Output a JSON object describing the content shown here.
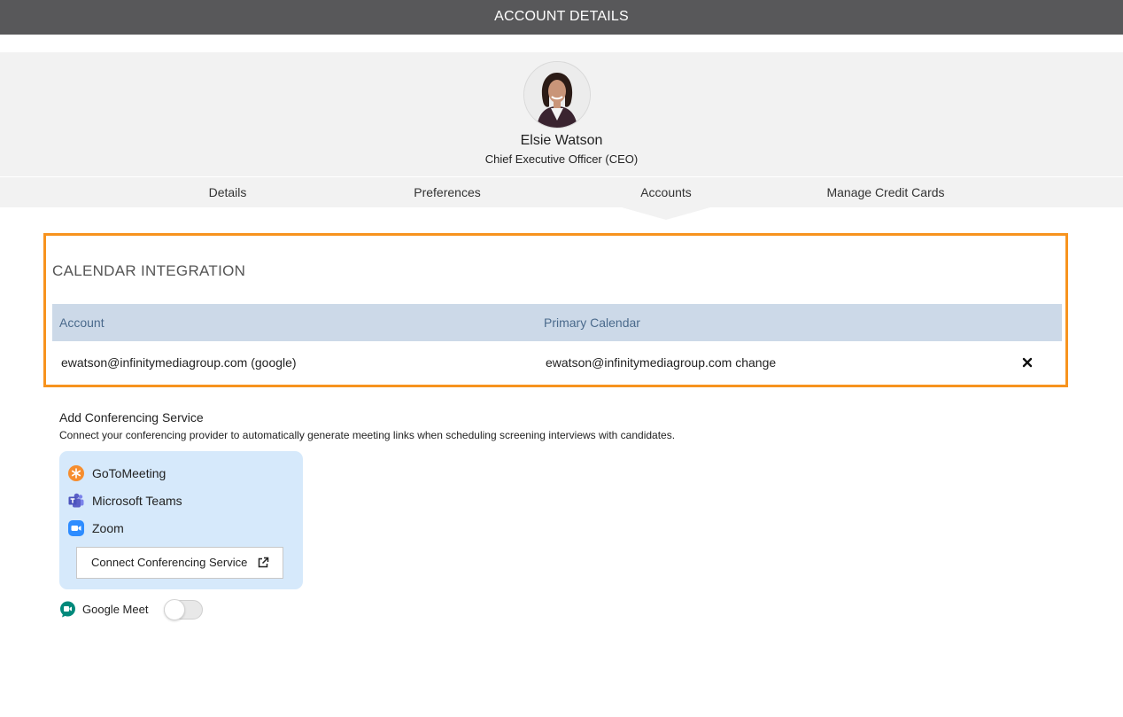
{
  "header": {
    "title": "ACCOUNT DETAILS"
  },
  "profile": {
    "name": "Elsie Watson",
    "role": "Chief Executive Officer (CEO)"
  },
  "tabs": [
    {
      "label": "Details"
    },
    {
      "label": "Preferences"
    },
    {
      "label": "Accounts",
      "active": true
    },
    {
      "label": "Manage Credit Cards"
    }
  ],
  "calendar": {
    "title": "CALENDAR INTEGRATION",
    "highlight_color": "#f7931e",
    "columns": {
      "account": "Account",
      "primary": "Primary Calendar"
    },
    "rows": [
      {
        "account": "ewatson@infinitymediagroup.com (google)",
        "primary": "ewatson@infinitymediagroup.com change",
        "remove_icon": "close-icon"
      }
    ]
  },
  "conferencing": {
    "title": "Add Conferencing Service",
    "description": "Connect your conferencing provider to automatically generate meeting links when scheduling screening interviews with candidates.",
    "services": [
      {
        "label": "GoToMeeting",
        "icon": "gotomeeting-icon",
        "color": "#f68d2e"
      },
      {
        "label": "Microsoft Teams",
        "icon": "microsoft-teams-icon",
        "color": "#5b5fc7"
      },
      {
        "label": "Zoom",
        "icon": "zoom-icon",
        "color": "#2d8cff"
      }
    ],
    "connect_button": "Connect Conferencing Service",
    "google_meet": {
      "label": "Google Meet",
      "enabled": false
    }
  }
}
